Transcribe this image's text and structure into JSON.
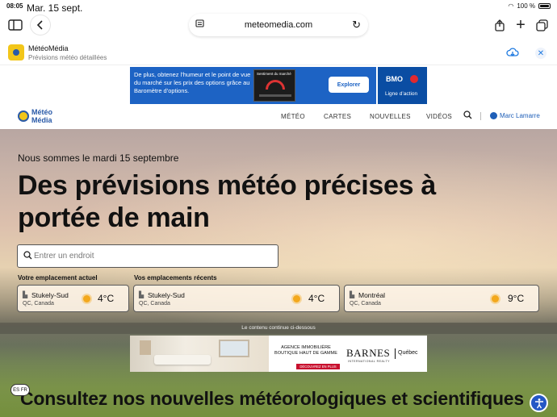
{
  "status": {
    "time": "08:05",
    "date": "Mar. 15 sept.",
    "battery": "100 %"
  },
  "browser": {
    "url": "meteomedia.com",
    "icons": [
      "sidebar-icon",
      "back-icon",
      "reader-icon",
      "reload-icon",
      "share-icon",
      "plus-icon",
      "tabs-icon"
    ]
  },
  "app_banner": {
    "name": "MétéoMédia",
    "subtitle": "Prévisions météo détaillées"
  },
  "ad_top": {
    "text": "De plus, obtenez l’humeur et le point de vue du marché sur les prix des options grâce au Baromètre d’options.",
    "chart_label": "Sentiment du marché",
    "cta": "Explorer",
    "brand": "BMO",
    "tagline": "Ligne d’action"
  },
  "site": {
    "logo_line1": "Météo",
    "logo_line2": "Média",
    "nav": [
      "MÉTÉO",
      "CARTES",
      "NOUVELLES",
      "VIDÉOS"
    ],
    "user": "Marc Lamarre",
    "accent": "#2a5aa8"
  },
  "hero": {
    "date": "Nous sommes le mardi 15 septembre",
    "headline": "Des prévisions météo précises à portée de main",
    "search_placeholder": "Entrer un endroit",
    "current_label": "Votre emplacement actuel",
    "recent_label": "Vos emplacements récents",
    "cards": [
      {
        "city": "Stukely-Sud",
        "region": "QC, Canada",
        "temp": "4°C"
      },
      {
        "city": "Stukely-Sud",
        "region": "QC, Canada",
        "temp": "4°C"
      },
      {
        "city": "Montréal",
        "region": "QC, Canada",
        "temp": "9°C"
      }
    ],
    "continue_text": "Le contenu continue ci-dessous"
  },
  "ad_bottom": {
    "agency": "AGENCE IMMOBILIÈRE BOUTIQUE HAUT DE GAMME",
    "discover": "DÉCOUVREZ EN PLUS",
    "brand": "BARNES",
    "region": "Québec",
    "intl": "INTERNATIONAL REALTY"
  },
  "section_title": "Consultez nos nouvelles météorologiques et scientifiques",
  "lang_toggle": "ES FR"
}
